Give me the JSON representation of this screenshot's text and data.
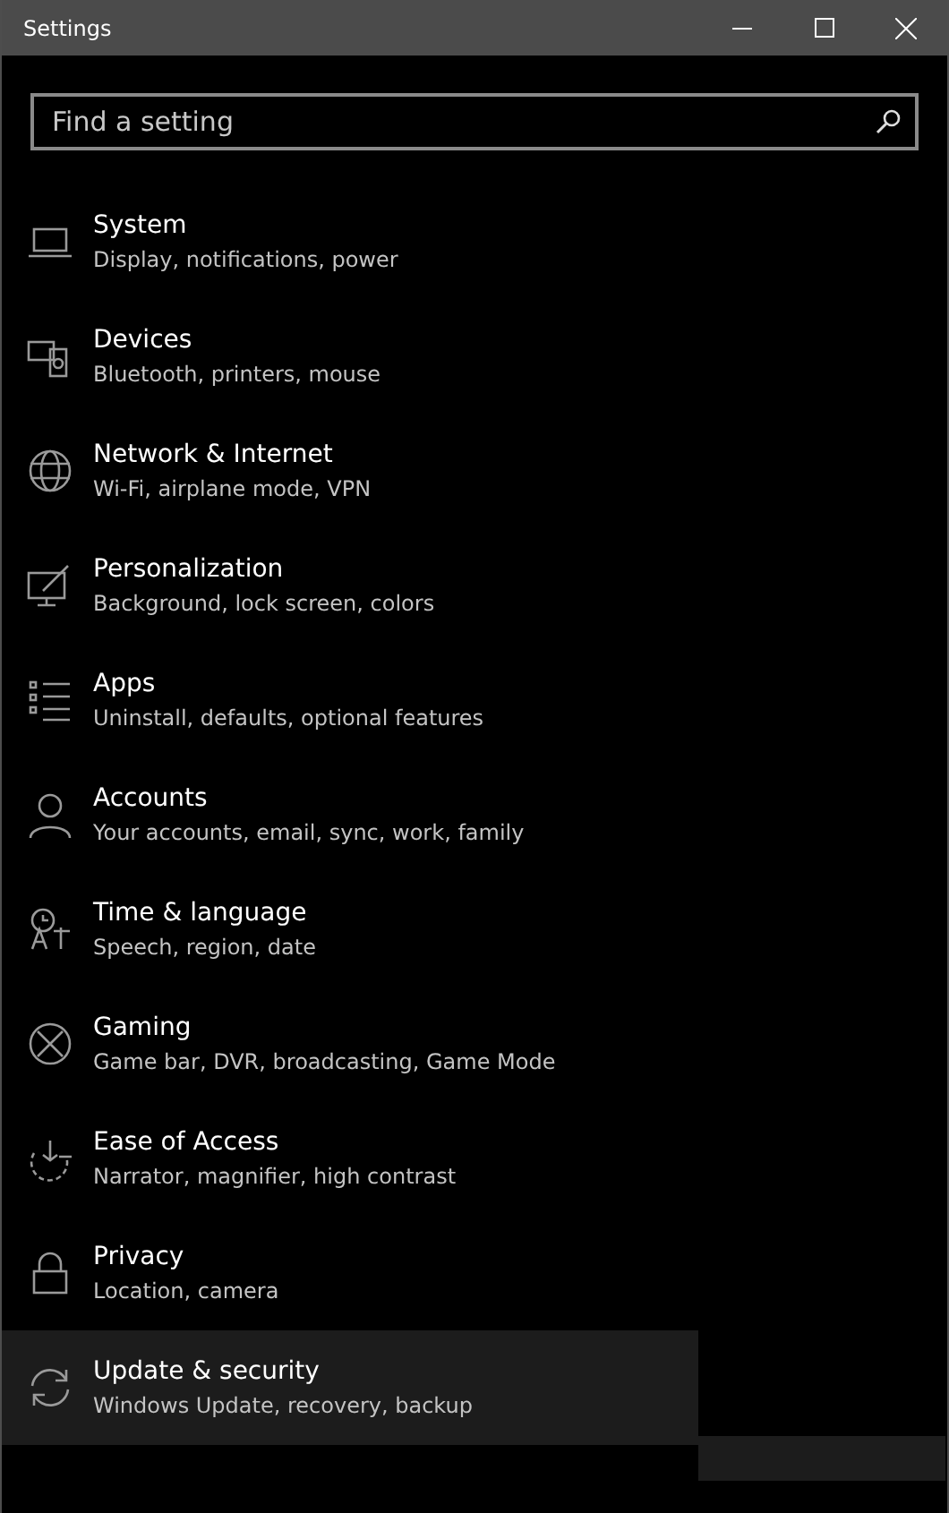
{
  "window": {
    "title": "Settings"
  },
  "search": {
    "placeholder": "Find a setting"
  },
  "items": [
    {
      "title": "System",
      "subtitle": "Display, notifications, power",
      "selected": false
    },
    {
      "title": "Devices",
      "subtitle": "Bluetooth, printers, mouse",
      "selected": false
    },
    {
      "title": "Network & Internet",
      "subtitle": "Wi-Fi, airplane mode, VPN",
      "selected": false
    },
    {
      "title": "Personalization",
      "subtitle": "Background, lock screen, colors",
      "selected": false
    },
    {
      "title": "Apps",
      "subtitle": "Uninstall, defaults, optional features",
      "selected": false
    },
    {
      "title": "Accounts",
      "subtitle": "Your accounts, email, sync, work, family",
      "selected": false
    },
    {
      "title": "Time & language",
      "subtitle": "Speech, region, date",
      "selected": false
    },
    {
      "title": "Gaming",
      "subtitle": "Game bar, DVR, broadcasting, Game Mode",
      "selected": false
    },
    {
      "title": "Ease of Access",
      "subtitle": "Narrator, magnifier, high contrast",
      "selected": false
    },
    {
      "title": "Privacy",
      "subtitle": "Location, camera",
      "selected": false
    },
    {
      "title": "Update & security",
      "subtitle": "Windows Update, recovery, backup",
      "selected": true
    }
  ]
}
